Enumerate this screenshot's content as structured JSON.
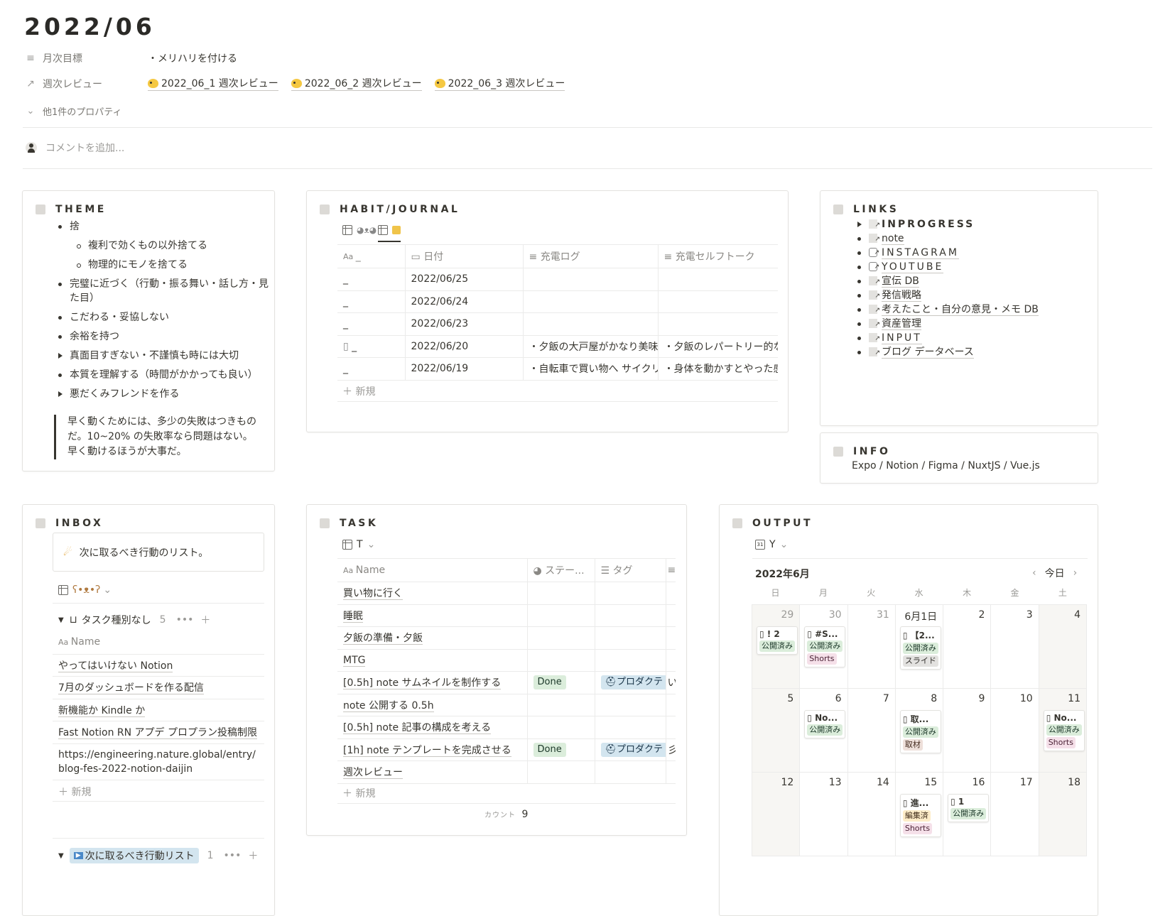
{
  "page": {
    "title": "2022/06",
    "properties": [
      {
        "label": "月次目標",
        "value": "・メリハリを付ける"
      },
      {
        "label": "週次レビュー",
        "relations": [
          "2022_06_1 週次レビュー",
          "2022_06_2 週次レビュー",
          "2022_06_3 週次レビュー"
        ]
      }
    ],
    "more_props": "他1件のプロパティ",
    "comment_placeholder": "コメントを追加..."
  },
  "theme": {
    "title": "THEME",
    "items": [
      {
        "text": "捨",
        "kind": "bullet"
      },
      {
        "text": "複利で効くもの以外捨てる",
        "kind": "sub"
      },
      {
        "text": "物理的にモノを捨てる",
        "kind": "sub"
      },
      {
        "text": "完璧に近づく（行動・振る舞い・話し方・見た目）",
        "kind": "bullet"
      },
      {
        "text": "こだわる・妥協しない",
        "kind": "bullet"
      },
      {
        "text": "余裕を持つ",
        "kind": "bullet"
      },
      {
        "text": "真面目すぎない・不謹慎も時には大切",
        "kind": "toggle"
      },
      {
        "text": "本質を理解する（時間がかかっても良い）",
        "kind": "bullet"
      },
      {
        "text": "悪だくみフレンドを作る",
        "kind": "toggle"
      }
    ],
    "quote": "早く動くためには、多少の失敗はつきものだ。10~20% の失敗率なら問題はない。早く動けるほうが大事だ。"
  },
  "habit": {
    "title": "HABIT/JOURNAL",
    "columns": [
      "_",
      "日付",
      "充電ログ",
      "充電セルフトーク"
    ],
    "rows": [
      [
        "_",
        "2022/06/25",
        "",
        ""
      ],
      [
        "_",
        "2022/06/24",
        "",
        ""
      ],
      [
        "_",
        "2022/06/23",
        "",
        ""
      ],
      [
        "_",
        "2022/06/20",
        "・夕飯の大戸屋がかなり美味し",
        "・夕飯のレパートリー的な"
      ],
      [
        "_",
        "2022/06/19",
        "・自転車で買い物へ サイクリン",
        "・身体を動かすとやった感"
      ]
    ],
    "new_label": "新規"
  },
  "links": {
    "title": "LINKS",
    "items": [
      "INPROGRESS",
      "note",
      "INSTAGRAM",
      "YOUTUBE",
      "宣伝 DB",
      "発信戦略",
      "考えたこと・自分の意見・メモ DB",
      "資産管理",
      "INPUT",
      "ブログ データベース"
    ]
  },
  "info": {
    "title": "INFO",
    "text": "Expo / Notion / Figma / NuxtJS / Vue.js"
  },
  "inbox": {
    "title": "INBOX",
    "callout": "次に取るべき行動のリスト。",
    "group1": {
      "label": "タスク種別なし",
      "count": "5"
    },
    "col": "Name",
    "rows": [
      "やってはいけない Notion",
      "7月のダッシュボードを作る配信",
      "新機能か Kindle か",
      "Fast Notion RN アプデ プロプラン投稿制限",
      "https://engineering.nature.global/entry/blog-fes-2022-notion-daijin"
    ],
    "new_label": "新規",
    "group2": {
      "label": "次に取るべき行動リスト",
      "count": "1"
    }
  },
  "task": {
    "title": "TASK",
    "view": "T",
    "columns": [
      "Name",
      "ステー...",
      "タグ"
    ],
    "rows": [
      {
        "name": "買い物に行く",
        "status": "",
        "tag": ""
      },
      {
        "name": "睡眠",
        "status": "",
        "tag": ""
      },
      {
        "name": "夕飯の準備・夕飯",
        "status": "",
        "tag": ""
      },
      {
        "name": "MTG",
        "status": "",
        "tag": ""
      },
      {
        "name": "[0.5h] note サムネイルを制作する",
        "status": "Done",
        "tag": "プロダクテ"
      },
      {
        "name": "note 公開する 0.5h",
        "status": "",
        "tag": ""
      },
      {
        "name": "[0.5h] note 記事の構成を考える",
        "status": "",
        "tag": ""
      },
      {
        "name": "[1h] note テンプレートを完成させる",
        "status": "Done",
        "tag": "プロダクテ"
      },
      {
        "name": "週次レビュー",
        "status": "",
        "tag": ""
      }
    ],
    "new_label": "新規",
    "count_label": "カウント",
    "count": "9"
  },
  "output": {
    "title": "OUTPUT",
    "view": "Y",
    "month": "2022年6月",
    "today": "今日",
    "dow": [
      "日",
      "月",
      "火",
      "水",
      "木",
      "金",
      "土"
    ],
    "days": [
      {
        "d": "29",
        "grey": true,
        "ev": {
          "t": "! 2",
          "p": [
            [
              "公開済み",
              "pub"
            ]
          ]
        }
      },
      {
        "d": "30",
        "grey": true,
        "ev": {
          "t": "#S...",
          "p": [
            [
              "公開済み",
              "pub"
            ],
            [
              "Shorts",
              "shorts"
            ]
          ]
        }
      },
      {
        "d": "31",
        "grey": true
      },
      {
        "d": "6月1日",
        "ev": {
          "t": "【2...",
          "p": [
            [
              "公開済み",
              "pub"
            ],
            [
              "スライド",
              "slide"
            ]
          ]
        }
      },
      {
        "d": "2"
      },
      {
        "d": "3"
      },
      {
        "d": "4"
      },
      {
        "d": "5"
      },
      {
        "d": "6",
        "ev": {
          "t": "No...",
          "p": [
            [
              "公開済み",
              "pub"
            ]
          ]
        }
      },
      {
        "d": "7"
      },
      {
        "d": "8",
        "ev": {
          "t": "取...",
          "p": [
            [
              "公開済み",
              "pub"
            ],
            [
              "取材",
              "src"
            ]
          ]
        }
      },
      {
        "d": "9"
      },
      {
        "d": "10"
      },
      {
        "d": "11",
        "ev": {
          "t": "No...",
          "p": [
            [
              "公開済み",
              "pub"
            ],
            [
              "Shorts",
              "shorts"
            ]
          ]
        }
      },
      {
        "d": "12"
      },
      {
        "d": "13"
      },
      {
        "d": "14"
      },
      {
        "d": "15",
        "ev": {
          "t": "進...",
          "p": [
            [
              "編集済",
              "edit"
            ],
            [
              "Shorts",
              "shorts"
            ]
          ]
        }
      },
      {
        "d": "16",
        "ev": {
          "t": "1",
          "p": [
            [
              "公開済み",
              "pub"
            ]
          ]
        }
      },
      {
        "d": "17"
      },
      {
        "d": "18"
      }
    ]
  }
}
